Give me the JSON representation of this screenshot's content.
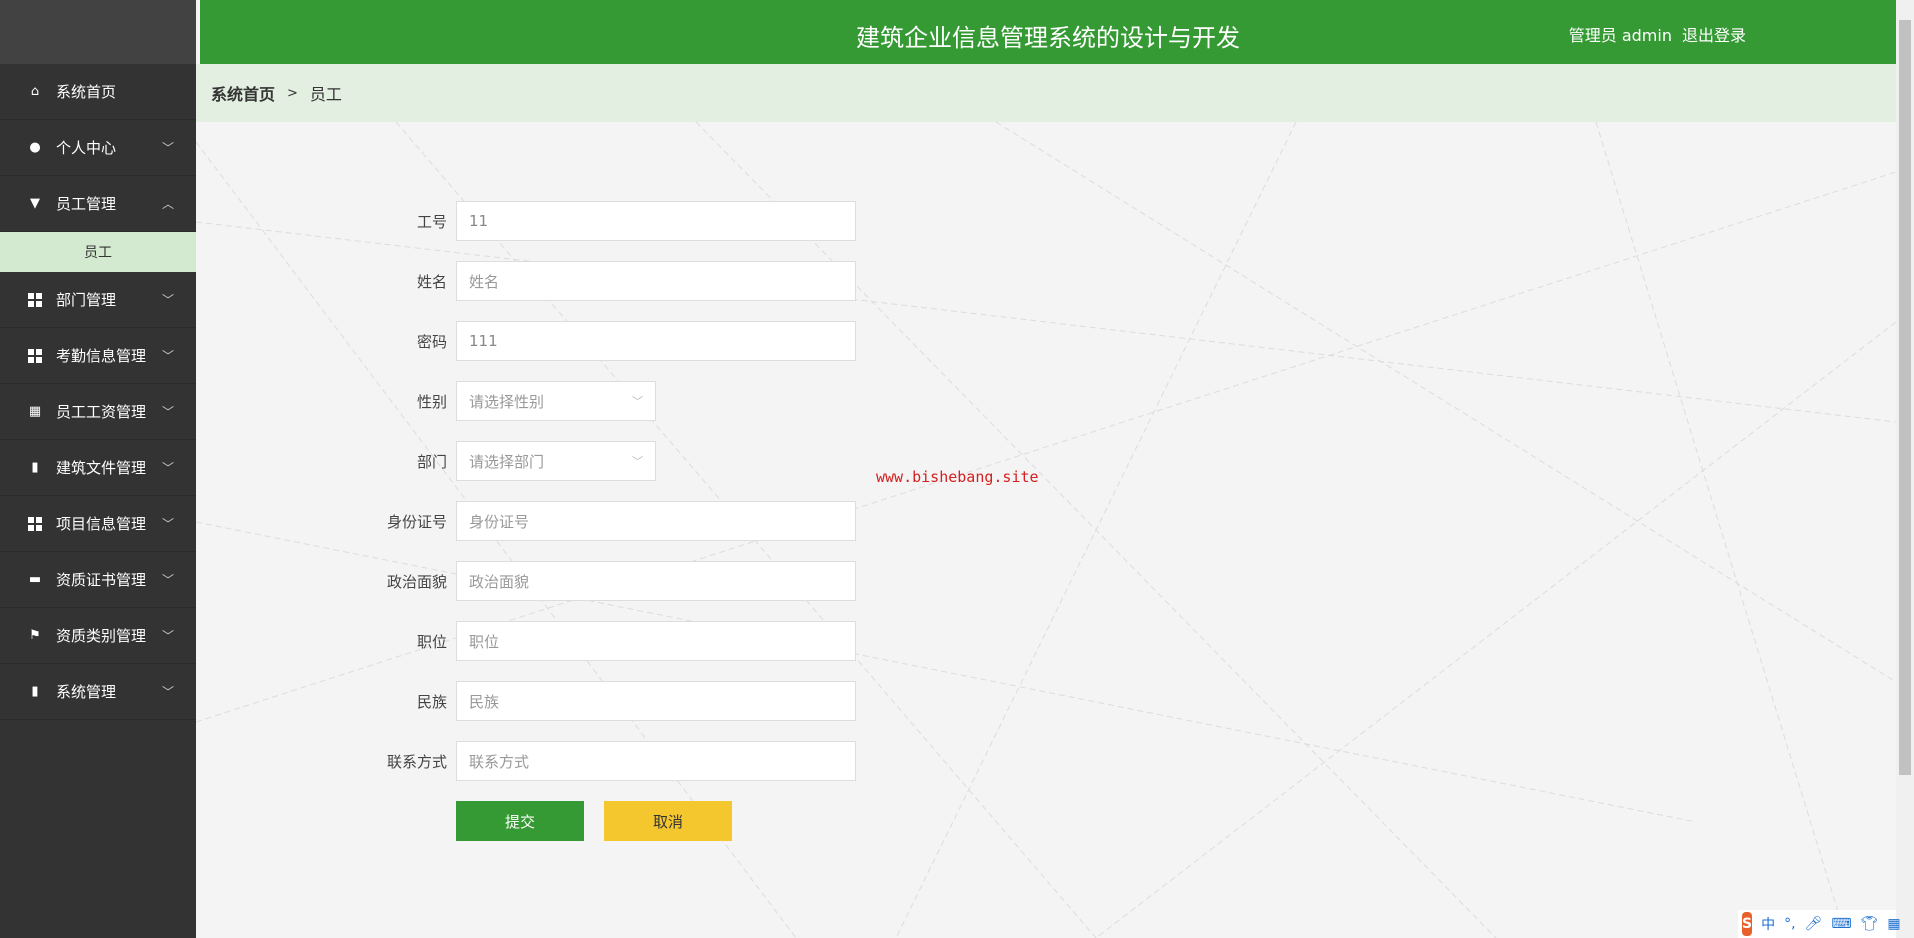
{
  "header": {
    "title": "建筑企业信息管理系统的设计与开发",
    "user": "管理员 admin",
    "logout": "退出登录"
  },
  "breadcrumb": {
    "home": "系统首页",
    "sep": ">",
    "current": "员工"
  },
  "sidebar": {
    "items": [
      {
        "label": "系统首页",
        "icon": "home-icon"
      },
      {
        "label": "个人中心",
        "icon": "user-icon"
      },
      {
        "label": "员工管理",
        "icon": "brush-icon",
        "expanded": true,
        "sub": [
          "员工"
        ]
      },
      {
        "label": "部门管理",
        "icon": "grid-icon"
      },
      {
        "label": "考勤信息管理",
        "icon": "grid-icon"
      },
      {
        "label": "员工工资管理",
        "icon": "table-icon"
      },
      {
        "label": "建筑文件管理",
        "icon": "clipboard-icon"
      },
      {
        "label": "项目信息管理",
        "icon": "grid-icon"
      },
      {
        "label": "资质证书管理",
        "icon": "ticket-icon"
      },
      {
        "label": "资质类别管理",
        "icon": "flag-icon"
      },
      {
        "label": "系统管理",
        "icon": "bar-chart-icon"
      }
    ]
  },
  "form": {
    "fields": [
      {
        "label": "工号",
        "value": "11",
        "placeholder": ""
      },
      {
        "label": "姓名",
        "value": "",
        "placeholder": "姓名"
      },
      {
        "label": "密码",
        "value": "111",
        "placeholder": ""
      },
      {
        "label": "性别",
        "value": "",
        "placeholder": "请选择性别"
      },
      {
        "label": "部门",
        "value": "",
        "placeholder": "请选择部门"
      },
      {
        "label": "身份证号",
        "value": "",
        "placeholder": "身份证号"
      },
      {
        "label": "政治面貌",
        "value": "",
        "placeholder": "政治面貌"
      },
      {
        "label": "职位",
        "value": "",
        "placeholder": "职位"
      },
      {
        "label": "民族",
        "value": "",
        "placeholder": "民族"
      },
      {
        "label": "联系方式",
        "value": "",
        "placeholder": "联系方式"
      }
    ],
    "submit": "提交",
    "cancel": "取消"
  },
  "watermark": "www.bishebang.site",
  "ime": {
    "lang": "中",
    "punct": "°,"
  },
  "colors": {
    "primary": "#369a34",
    "cancel": "#f5c72f",
    "sidebar": "#333333"
  }
}
